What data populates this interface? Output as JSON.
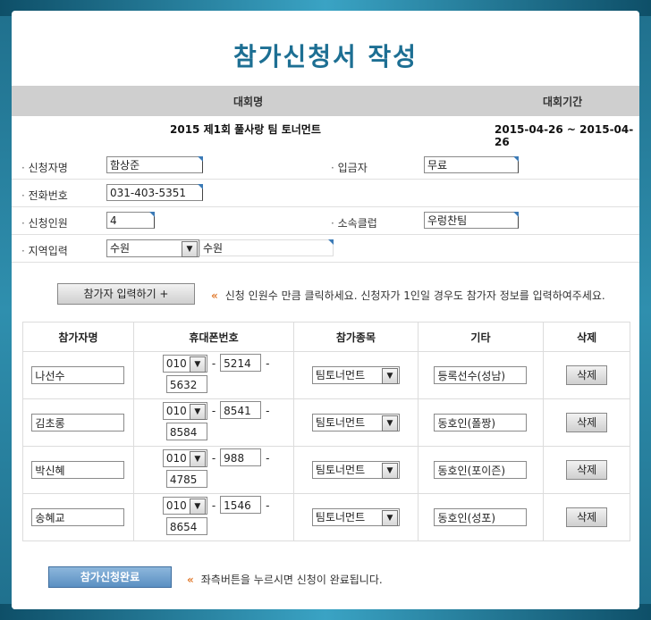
{
  "page": {
    "title": "참가신청서 작성"
  },
  "competition": {
    "name_header": "대회명",
    "period_header": "대회기간",
    "name": "2015 제1회 풀사랑 팀 토너먼트",
    "period": "2015-04-26 ~ 2015-04-26"
  },
  "form": {
    "applicant_label": "신청자명",
    "applicant_value": "함상준",
    "deposit_label": "입금자",
    "deposit_value": "무료",
    "phone_label": "전화번호",
    "phone_value": "031-403-5351",
    "count_label": "신청인원",
    "count_value": "4",
    "club_label": "소속클럽",
    "club_value": "우렁찬팀",
    "region_label": "지역입력",
    "region_select": "수원",
    "region_value": "수원"
  },
  "add": {
    "button_label": "참가자 입력하기 +",
    "hint": "신청 인원수 만큼 클릭하세요.  신청자가 1인일 경우도 참가자 정보를 입력하여주세요."
  },
  "table": {
    "headers": [
      "참가자명",
      "휴대폰번호",
      "참가종목",
      "기타",
      "삭제"
    ],
    "rows": [
      {
        "name": "나선수",
        "phone1": "010",
        "phone2": "5214",
        "phone3": "5632",
        "event": "팀토너먼트",
        "etc": "등록선수(성남)",
        "delete": "삭제"
      },
      {
        "name": "김초롱",
        "phone1": "010",
        "phone2": "8541",
        "phone3": "8584",
        "event": "팀토너먼트",
        "etc": "동호인(폴짱)",
        "delete": "삭제"
      },
      {
        "name": "박신혜",
        "phone1": "010",
        "phone2": "988",
        "phone3": "4785",
        "event": "팀토너먼트",
        "etc": "동호인(포이즌)",
        "delete": "삭제"
      },
      {
        "name": "송혜교",
        "phone1": "010",
        "phone2": "1546",
        "phone3": "8654",
        "event": "팀토너먼트",
        "etc": "동호인(성포)",
        "delete": "삭제"
      }
    ]
  },
  "submit": {
    "button_label": "참가신청완료",
    "hint": "좌측버튼을 누르시면 신청이 완료됩니다."
  },
  "colors": {
    "title": "#1d6f93",
    "frame": "#1f6f8c",
    "accent_arrow": "#e0782a"
  }
}
